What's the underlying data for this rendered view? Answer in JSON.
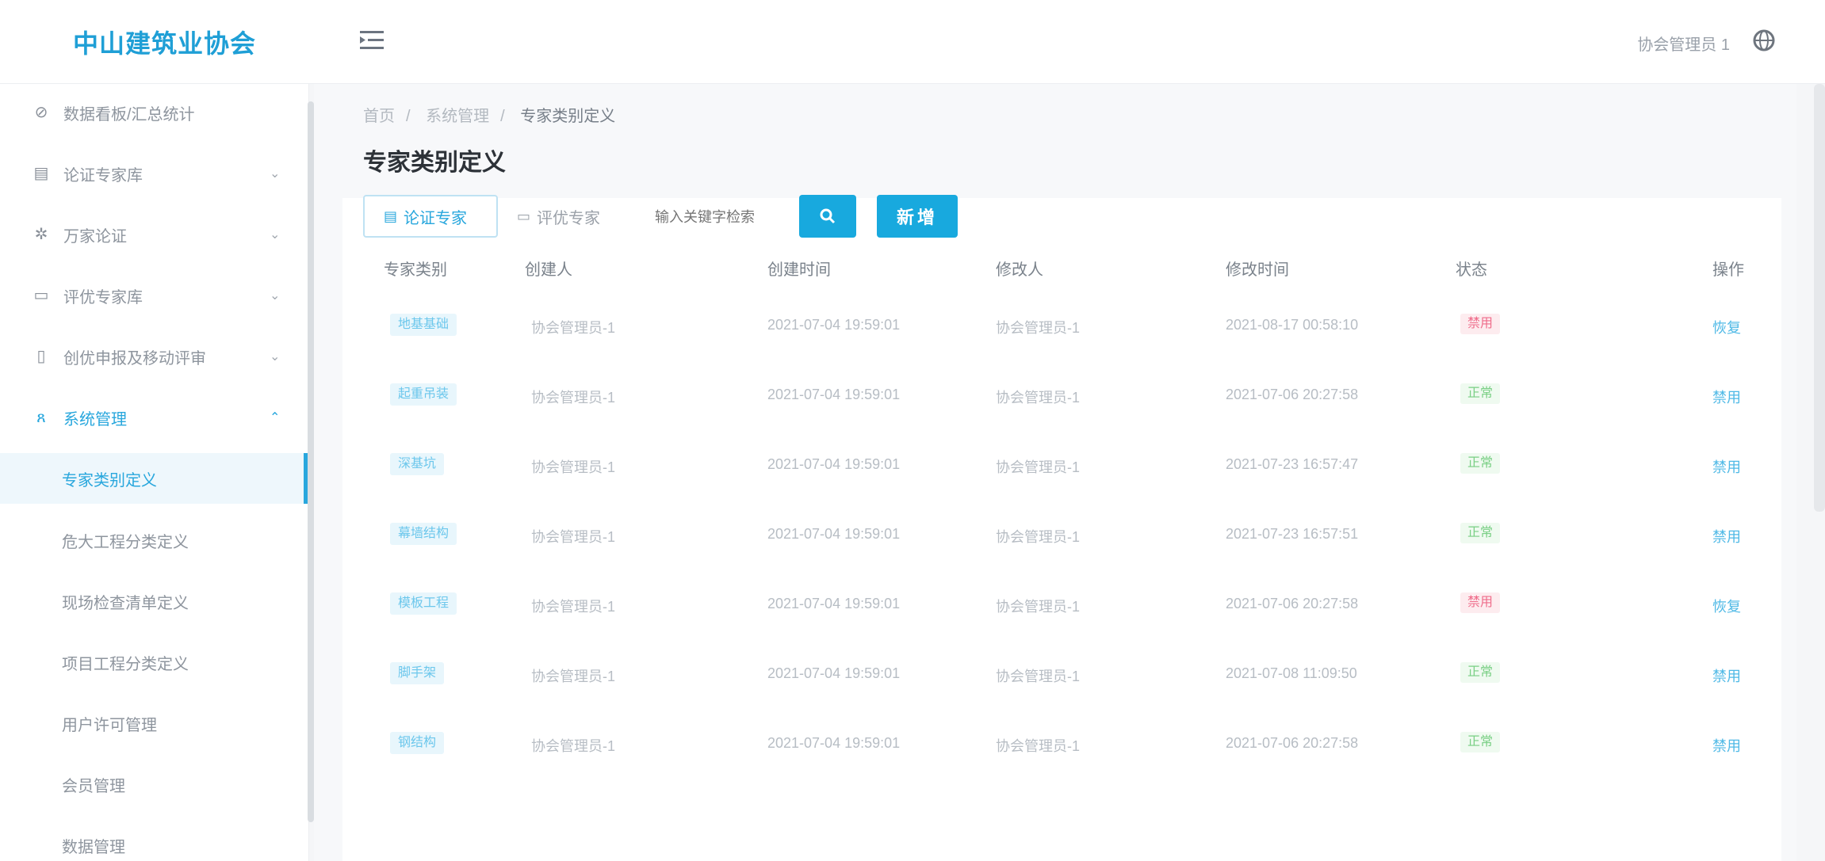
{
  "header": {
    "logo": "中山建筑业协会",
    "user": "协会管理员 1"
  },
  "sidebar": {
    "items": [
      {
        "label": "数据看板/汇总统计",
        "icon": "dashboard-icon",
        "has_children": false
      },
      {
        "label": "论证专家库",
        "icon": "document-icon",
        "has_children": true
      },
      {
        "label": "万家论证",
        "icon": "gear-icon",
        "has_children": true
      },
      {
        "label": "评优专家库",
        "icon": "card-icon",
        "has_children": true
      },
      {
        "label": "创优申报及移动评审",
        "icon": "mobile-icon",
        "has_children": true
      },
      {
        "label": "系统管理",
        "icon": "user-icon",
        "has_children": true,
        "expanded": true
      }
    ],
    "sub_items": [
      {
        "label": "专家类别定义",
        "active": true
      },
      {
        "label": "危大工程分类定义",
        "active": false
      },
      {
        "label": "现场检查清单定义",
        "active": false
      },
      {
        "label": "项目工程分类定义",
        "active": false
      },
      {
        "label": "用户许可管理",
        "active": false
      },
      {
        "label": "会员管理",
        "active": false
      },
      {
        "label": "数据管理",
        "active": false
      }
    ]
  },
  "breadcrumb": [
    "首页",
    "系统管理",
    "专家类别定义"
  ],
  "page_title": "专家类别定义",
  "filters": {
    "tab_active": "论证专家",
    "tab_other": "评优专家",
    "search_placeholder": "输入关键字检索"
  },
  "buttons": {
    "add": "新增"
  },
  "table": {
    "columns": [
      "专家类别",
      "创建人",
      "创建时间",
      "修改人",
      "修改时间",
      "状态",
      "操作"
    ],
    "rows": [
      {
        "category": "地基基础",
        "creator": "协会管理员-1",
        "created": "2021-07-04 19:59:01",
        "modifier": "协会管理员-1",
        "modified": "2021-08-17 00:58:10",
        "status": "禁用",
        "status_type": "disabled",
        "op": "恢复"
      },
      {
        "category": "起重吊装",
        "creator": "协会管理员-1",
        "created": "2021-07-04 19:59:01",
        "modifier": "协会管理员-1",
        "modified": "2021-07-06 20:27:58",
        "status": "正常",
        "status_type": "enabled",
        "op": "禁用"
      },
      {
        "category": "深基坑",
        "creator": "协会管理员-1",
        "created": "2021-07-04 19:59:01",
        "modifier": "协会管理员-1",
        "modified": "2021-07-23 16:57:47",
        "status": "正常",
        "status_type": "enabled",
        "op": "禁用"
      },
      {
        "category": "幕墙结构",
        "creator": "协会管理员-1",
        "created": "2021-07-04 19:59:01",
        "modifier": "协会管理员-1",
        "modified": "2021-07-23 16:57:51",
        "status": "正常",
        "status_type": "enabled",
        "op": "禁用"
      },
      {
        "category": "模板工程",
        "creator": "协会管理员-1",
        "created": "2021-07-04 19:59:01",
        "modifier": "协会管理员-1",
        "modified": "2021-07-06 20:27:58",
        "status": "禁用",
        "status_type": "disabled",
        "op": "恢复"
      },
      {
        "category": "脚手架",
        "creator": "协会管理员-1",
        "created": "2021-07-04 19:59:01",
        "modifier": "协会管理员-1",
        "modified": "2021-07-08 11:09:50",
        "status": "正常",
        "status_type": "enabled",
        "op": "禁用"
      },
      {
        "category": "钢结构",
        "creator": "协会管理员-1",
        "created": "2021-07-04 19:59:01",
        "modifier": "协会管理员-1",
        "modified": "2021-07-06 20:27:58",
        "status": "正常",
        "status_type": "enabled",
        "op": "禁用"
      }
    ]
  }
}
